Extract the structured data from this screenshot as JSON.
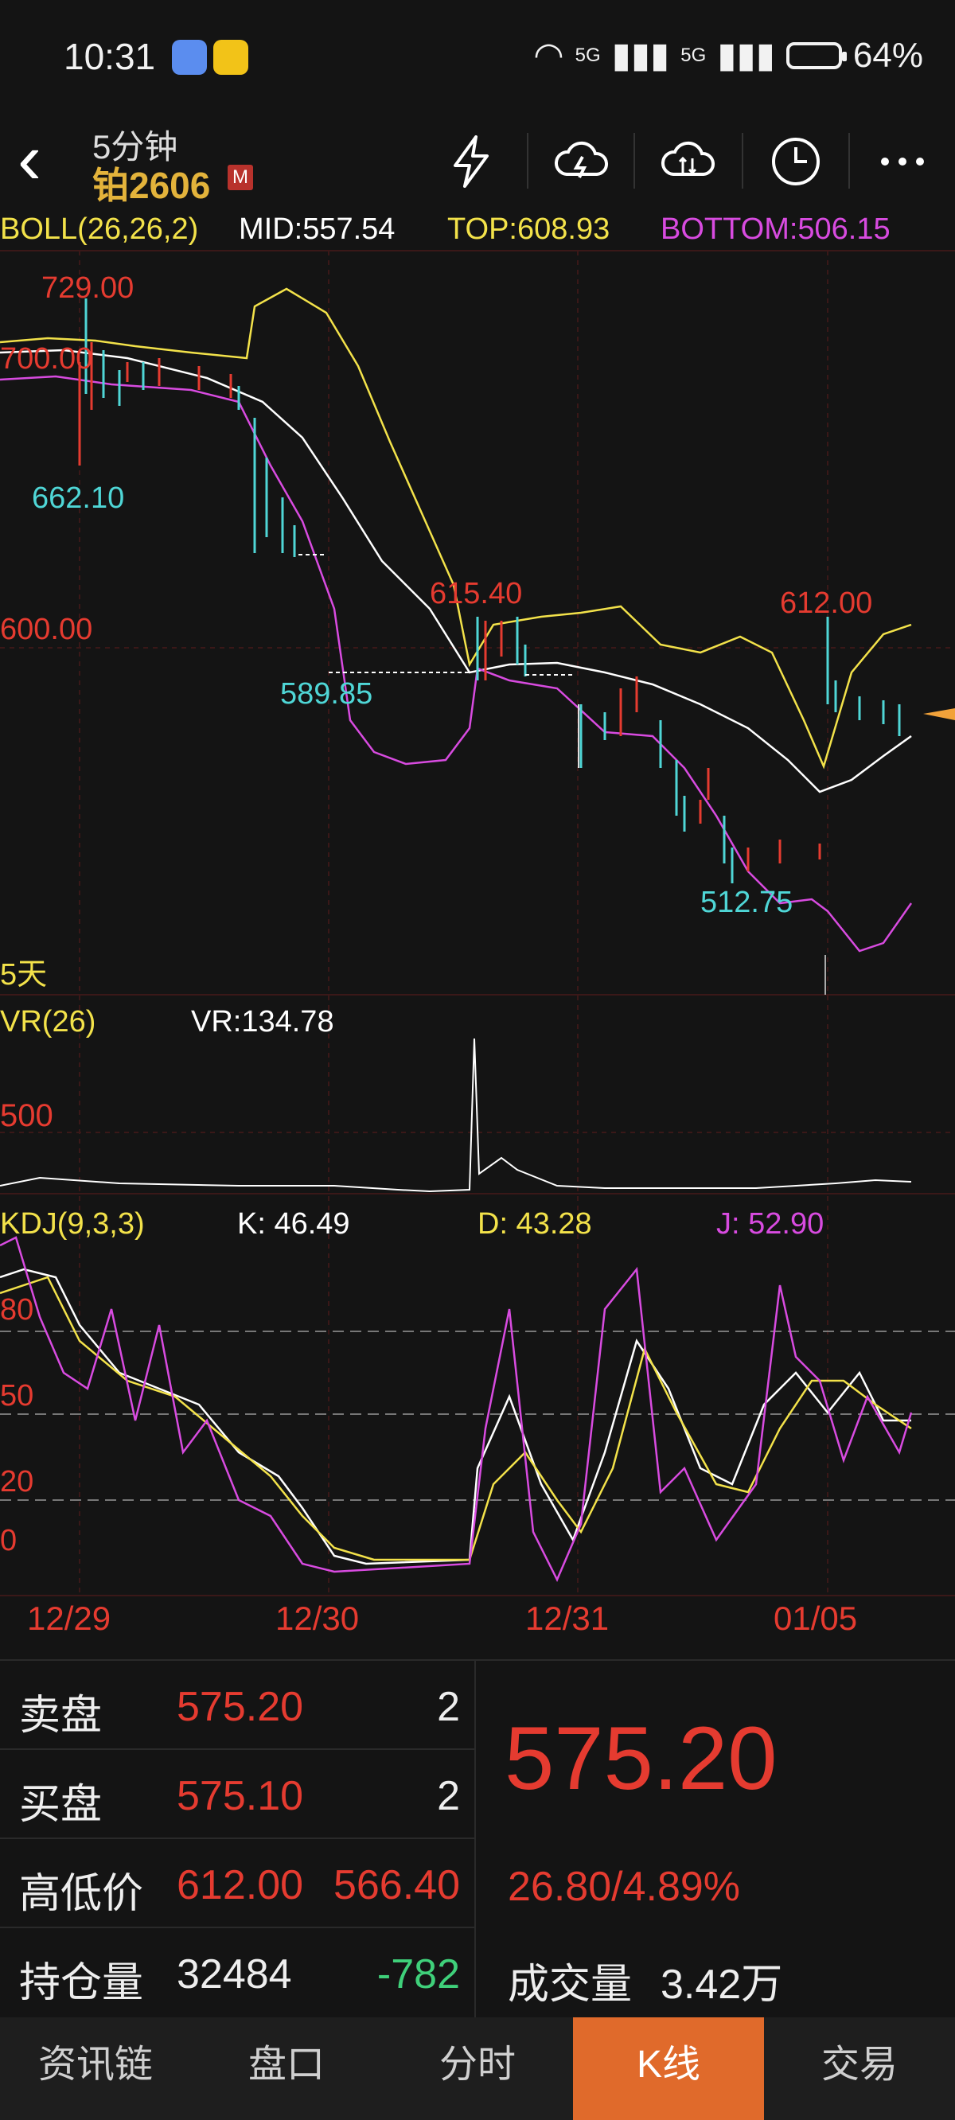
{
  "status": {
    "time": "10:31",
    "battery": "64%",
    "signal1": "5G",
    "signal2": "5G"
  },
  "header": {
    "period": "5分钟",
    "name": "铂2606",
    "badge": "M"
  },
  "boll": {
    "label": "BOLL(26,26,2)",
    "mid": "MID:557.54",
    "top": "TOP:608.93",
    "bottom": "BOTTOM:506.15",
    "color_mid": "#ffffff",
    "color_top": "#f3e24a",
    "color_bottom": "#d84be0"
  },
  "price_labels": {
    "high1": "729.00",
    "low1": "662.10",
    "p700": "700.00",
    "p600": "600.00",
    "mark615": "615.40",
    "mark589": "589.85",
    "mark612": "612.00",
    "mark512": "512.75",
    "range": "5天"
  },
  "vr": {
    "label": "VR(26)",
    "value": "VR:134.78",
    "tick": "500"
  },
  "kdj": {
    "label": "KDJ(9,3,3)",
    "k": "K: 46.49",
    "d": "D: 43.28",
    "j": "J: 52.90",
    "ticks": [
      "80",
      "50",
      "20",
      "0"
    ]
  },
  "dates": [
    "12/29",
    "12/30",
    "12/31",
    "01/05"
  ],
  "chart_data": {
    "type": "line",
    "title": "",
    "x": [
      "12/29",
      "12/30",
      "12/31",
      "01/05"
    ],
    "series": [
      {
        "name": "MID",
        "values": [
          695,
          670,
          590,
          575,
          560,
          548,
          575
        ]
      },
      {
        "name": "TOP",
        "values": [
          705,
          750,
          615,
          610,
          615,
          600,
          608.93
        ]
      },
      {
        "name": "BOTTOM",
        "values": [
          690,
          620,
          575,
          570,
          530,
          515,
          506.15
        ]
      }
    ],
    "annotations": [
      "729.00",
      "662.10",
      "615.40",
      "589.85",
      "612.00",
      "512.75"
    ]
  },
  "quote": {
    "rows": [
      {
        "key": "卖盘",
        "val": "575.20",
        "num": "2"
      },
      {
        "key": "买盘",
        "val": "575.10",
        "num": "2"
      },
      {
        "key": "高低价",
        "val": "612.00",
        "num": "566.40"
      },
      {
        "key": "持仓量",
        "val": "32484",
        "num": "-782"
      }
    ],
    "last": "575.20",
    "change": "26.80/4.89%",
    "volume_key": "成交量",
    "volume": "3.42万"
  },
  "tabs": [
    "资讯链",
    "盘口",
    "分时",
    "K线",
    "交易"
  ],
  "active_tab": "K线"
}
